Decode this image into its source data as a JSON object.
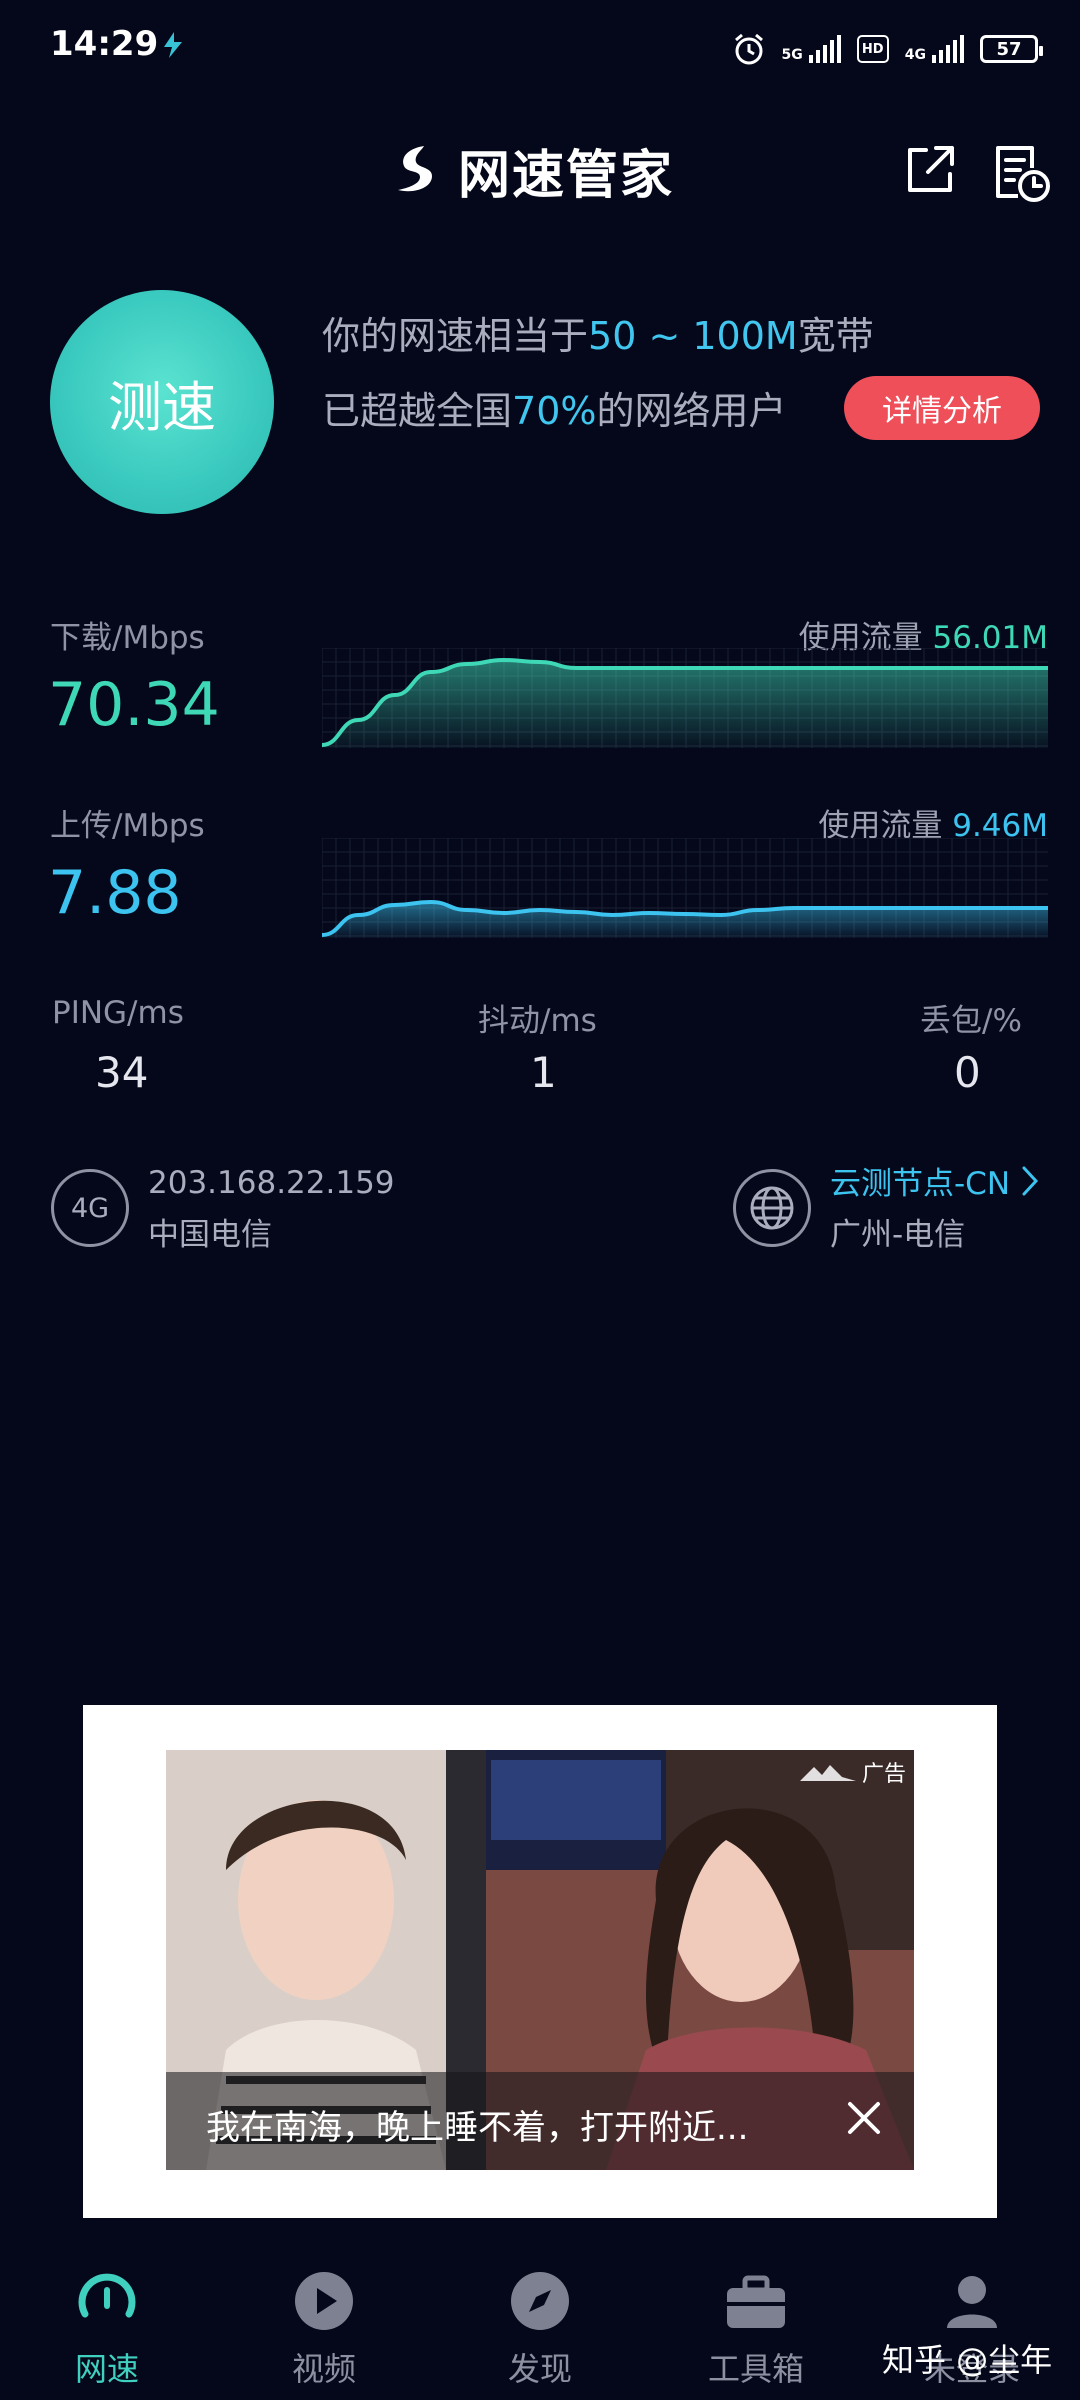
{
  "status_bar": {
    "time": "14:29",
    "network_1": "5G",
    "network_2": "4G",
    "hd": "HD",
    "battery": "57"
  },
  "header": {
    "title": "网速管家",
    "share_icon": "share-icon",
    "history_icon": "history-icon"
  },
  "speed_test": {
    "button_label": "测速",
    "summary_prefix": "你的网速相当于",
    "summary_range": "50 ~ 100M",
    "summary_suffix": "宽带",
    "rank_prefix": "已超越全国",
    "rank_percent": "70%",
    "rank_suffix": "的网络用户",
    "detail_button": "详情分析"
  },
  "download": {
    "label": "下载/Mbps",
    "value": "70.34",
    "usage_label": "使用流量",
    "usage_value": "56.01M",
    "color": "#3fd8b6",
    "curve": [
      0.05,
      0.3,
      0.55,
      0.78,
      0.86,
      0.9,
      0.88,
      0.82,
      0.82,
      0.82,
      0.82,
      0.82,
      0.82,
      0.82,
      0.82,
      0.82,
      0.82,
      0.82,
      0.82,
      0.82,
      0.82
    ]
  },
  "upload": {
    "label": "上传/Mbps",
    "value": "7.88",
    "usage_label": "使用流量",
    "usage_value": "9.46M",
    "color": "#3cc3ef",
    "curve": [
      0.05,
      0.25,
      0.35,
      0.38,
      0.3,
      0.27,
      0.3,
      0.28,
      0.25,
      0.27,
      0.26,
      0.25,
      0.3,
      0.32,
      0.32,
      0.32,
      0.32,
      0.32,
      0.32,
      0.32,
      0.32
    ]
  },
  "stats": {
    "ping_label": "PING/ms",
    "ping_value": "34",
    "jitter_label": "抖动/ms",
    "jitter_value": "1",
    "loss_label": "丢包/%",
    "loss_value": "0"
  },
  "network": {
    "type": "4G",
    "ip": "203.168.22.159",
    "carrier": "中国电信",
    "node_title": "云测节点-CN",
    "node_location": "广州-电信"
  },
  "ad": {
    "badge": "广告",
    "caption": "我在南海，晚上睡不着，打开附近..."
  },
  "nav": {
    "items": [
      {
        "label": "网速",
        "icon": "speedometer-icon",
        "active": true
      },
      {
        "label": "视频",
        "icon": "play-icon"
      },
      {
        "label": "发现",
        "icon": "compass-icon"
      },
      {
        "label": "工具箱",
        "icon": "toolbox-icon"
      },
      {
        "label": "未登录",
        "icon": "user-icon"
      }
    ]
  },
  "watermark": "知乎 @尘年",
  "colors": {
    "background": "#05081a",
    "accent_green": "#3fd8b6",
    "accent_blue": "#3cc3ef",
    "detail_red": "#ee4f59"
  }
}
